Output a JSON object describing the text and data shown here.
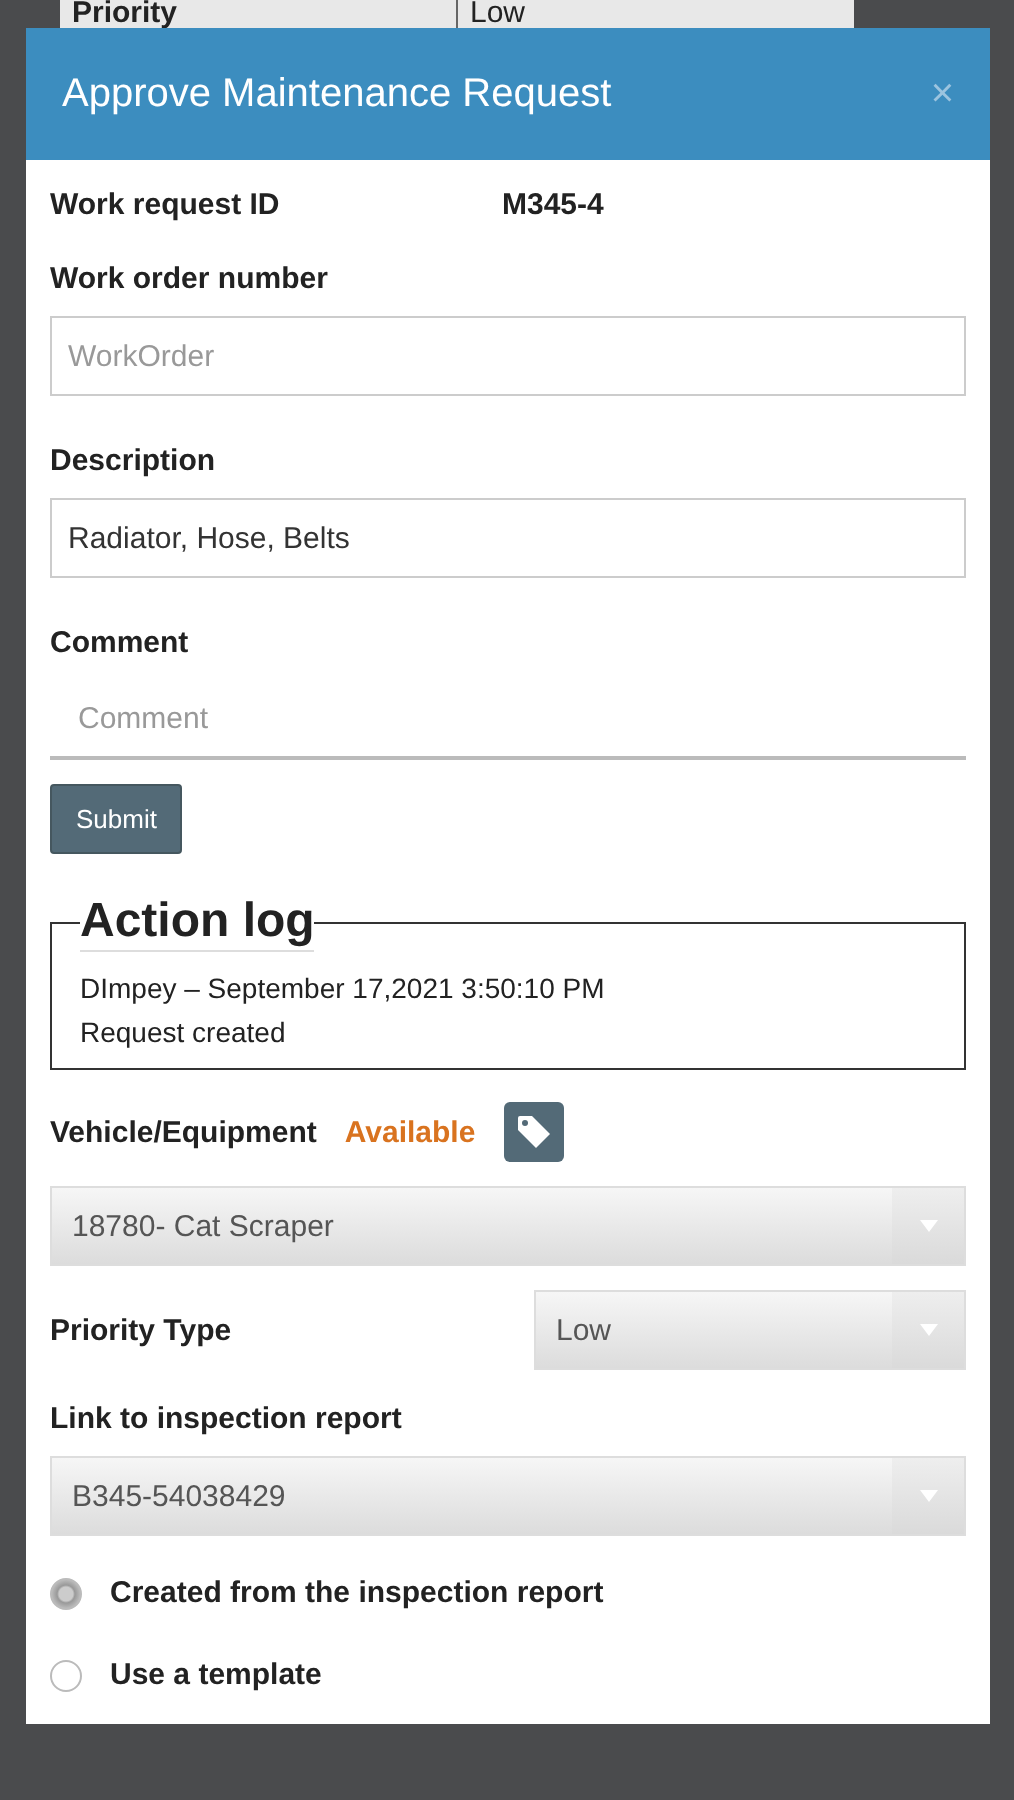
{
  "backdrop": {
    "cells": [
      "Priority",
      "Low"
    ]
  },
  "dialog": {
    "title": "Approve Maintenance Request",
    "close": "×"
  },
  "items": [
    {
      "kind": "info",
      "label": "Work request ID",
      "value": "M345-4"
    },
    {
      "kind": "label",
      "text": "Work order number"
    },
    {
      "kind": "input",
      "placeholder": "WorkOrder"
    },
    {
      "kind": "label",
      "text": "Description"
    },
    {
      "kind": "input",
      "value": "Radiator, Hose, Belts"
    },
    {
      "kind": "label",
      "text": "Comment"
    },
    {
      "kind": "underline",
      "placeholder": "Comment"
    },
    {
      "kind": "button",
      "label": "Submit"
    },
    {
      "kind": "log",
      "legend": "Action log",
      "lines": [
        "DImpey – September 17,2021 3:50:10 PM",
        "Request created"
      ]
    },
    {
      "kind": "status",
      "label": "Vehicle/Equipment",
      "status": "Available"
    },
    {
      "kind": "select",
      "value": "18780- Cat Scraper"
    },
    {
      "kind": "inline-select",
      "label": "Priority Type",
      "value": "Low"
    },
    {
      "kind": "label",
      "text": "Link to inspection report"
    },
    {
      "kind": "select",
      "value": "B345-54038429"
    },
    {
      "kind": "radio",
      "label": "Created from the inspection report",
      "selected": true
    },
    {
      "kind": "radio",
      "label": "Use a template",
      "selected": false
    }
  ]
}
